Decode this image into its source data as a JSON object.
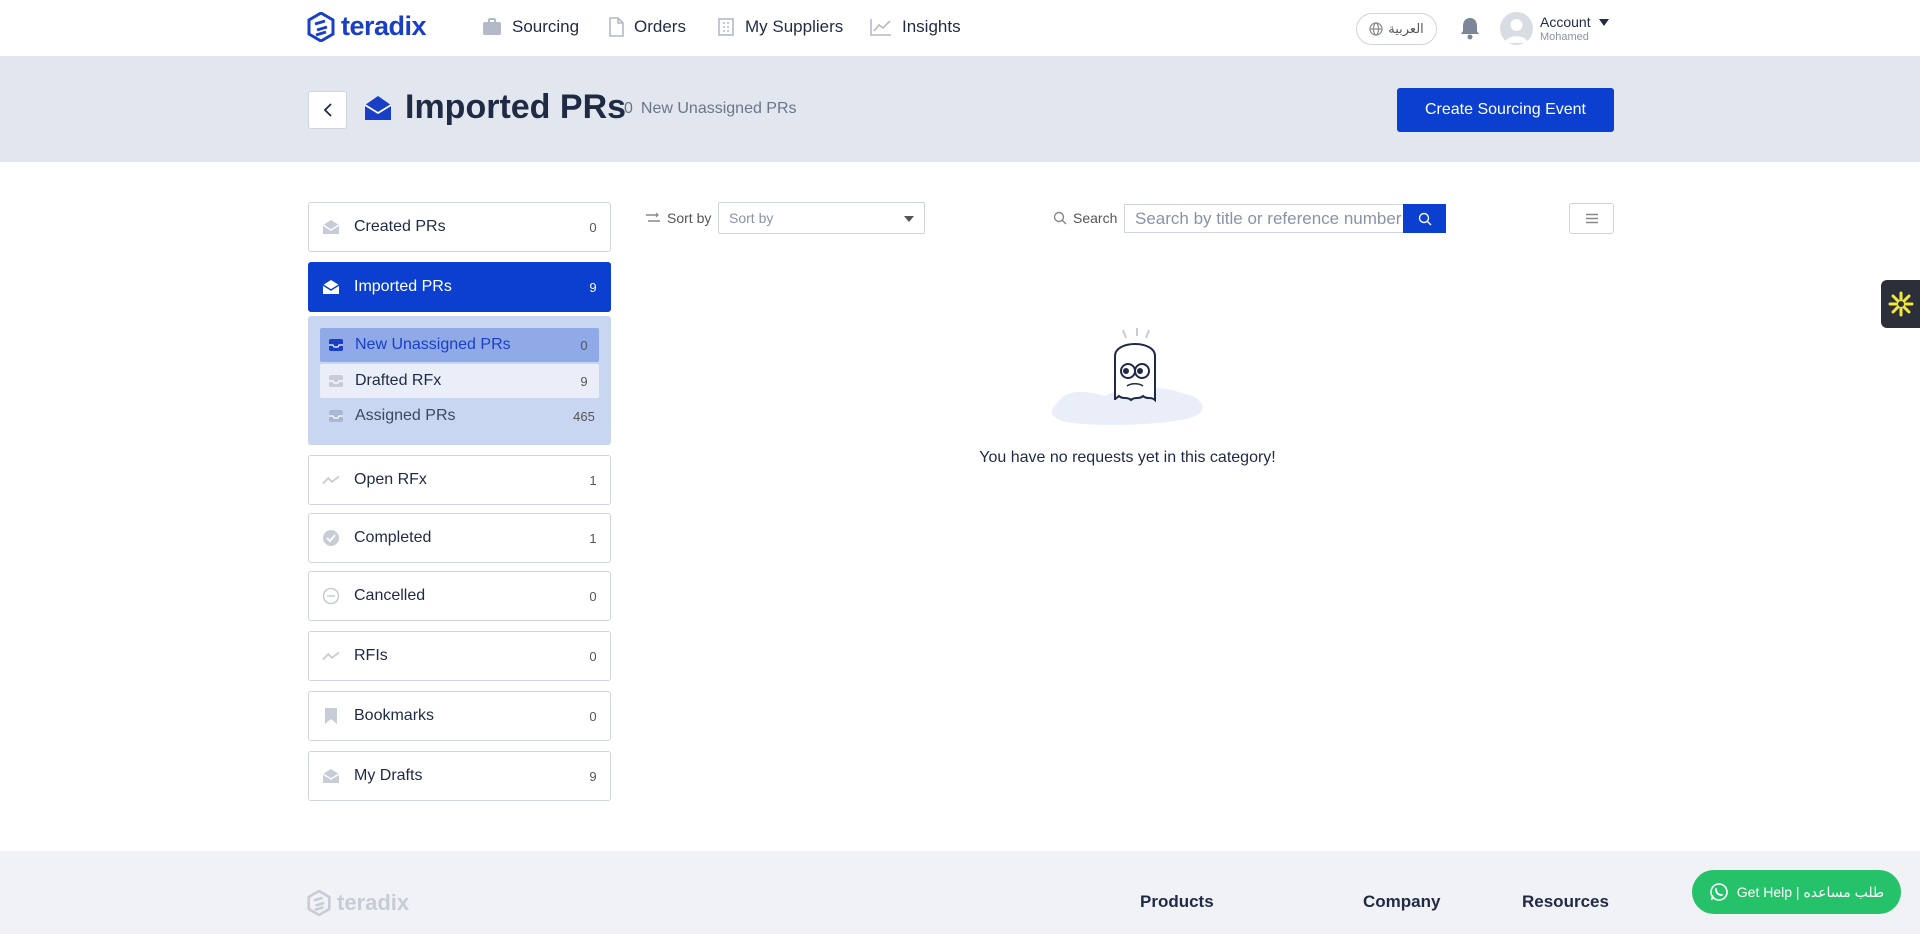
{
  "brand": {
    "name": "teradix"
  },
  "nav": {
    "items": [
      {
        "label": "Sourcing"
      },
      {
        "label": "Orders"
      },
      {
        "label": "My Suppliers"
      },
      {
        "label": "Insights"
      }
    ],
    "language": "العربية",
    "account_label": "Account",
    "account_user": "Mohamed"
  },
  "header": {
    "title": "Imported PRs",
    "count": "0",
    "count_label": "New Unassigned PRs",
    "create_button": "Create Sourcing Event"
  },
  "sidebar": {
    "items": [
      {
        "label": "Created PRs",
        "count": "0"
      },
      {
        "label": "Imported PRs",
        "count": "9"
      },
      {
        "label": "Open RFx",
        "count": "1"
      },
      {
        "label": "Completed",
        "count": "1"
      },
      {
        "label": "Cancelled",
        "count": "0"
      },
      {
        "label": "RFIs",
        "count": "0"
      },
      {
        "label": "Bookmarks",
        "count": "0"
      },
      {
        "label": "My Drafts",
        "count": "9"
      }
    ],
    "subitems": [
      {
        "label": "New Unassigned PRs",
        "count": "0"
      },
      {
        "label": "Drafted RFx",
        "count": "9"
      },
      {
        "label": "Assigned PRs",
        "count": "465"
      }
    ]
  },
  "toolbar": {
    "sort_label": "Sort by",
    "sort_value": "Sort by",
    "search_label": "Search",
    "search_placeholder": "Search by title or reference number"
  },
  "empty_state": {
    "message": "You have no requests yet in this category!"
  },
  "footer": {
    "logo": "teradix",
    "columns": [
      "Products",
      "Company",
      "Resources"
    ],
    "help_button": "Get Help | طلب مساعده"
  },
  "colors": {
    "primary": "#0a3fcf",
    "header_band": "#e2e6ee",
    "help_green": "#25c26a"
  }
}
